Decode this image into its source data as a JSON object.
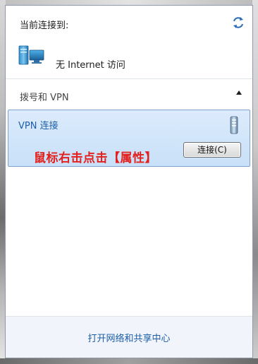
{
  "current": {
    "label": "当前连接到:",
    "network_status": "无 Internet 访问",
    "refresh_icon": "refresh-arrows-icon",
    "network_icon": "network-computer-icon"
  },
  "dialup": {
    "section_label": "拨号和 VPN",
    "collapse_icon": "chevron-up-icon",
    "vpn": {
      "name": "VPN 连接",
      "icon": "vpn-connection-icon",
      "annotation": "鼠标右击点击【属性】",
      "connect_label": "连接(C)"
    }
  },
  "footer": {
    "link": "打开网络和共享中心"
  },
  "colors": {
    "accent": "#1d5ea8",
    "annotation": "#e3201c",
    "selected_bg": "#dcebfc",
    "selected_border": "#7da2ce"
  }
}
